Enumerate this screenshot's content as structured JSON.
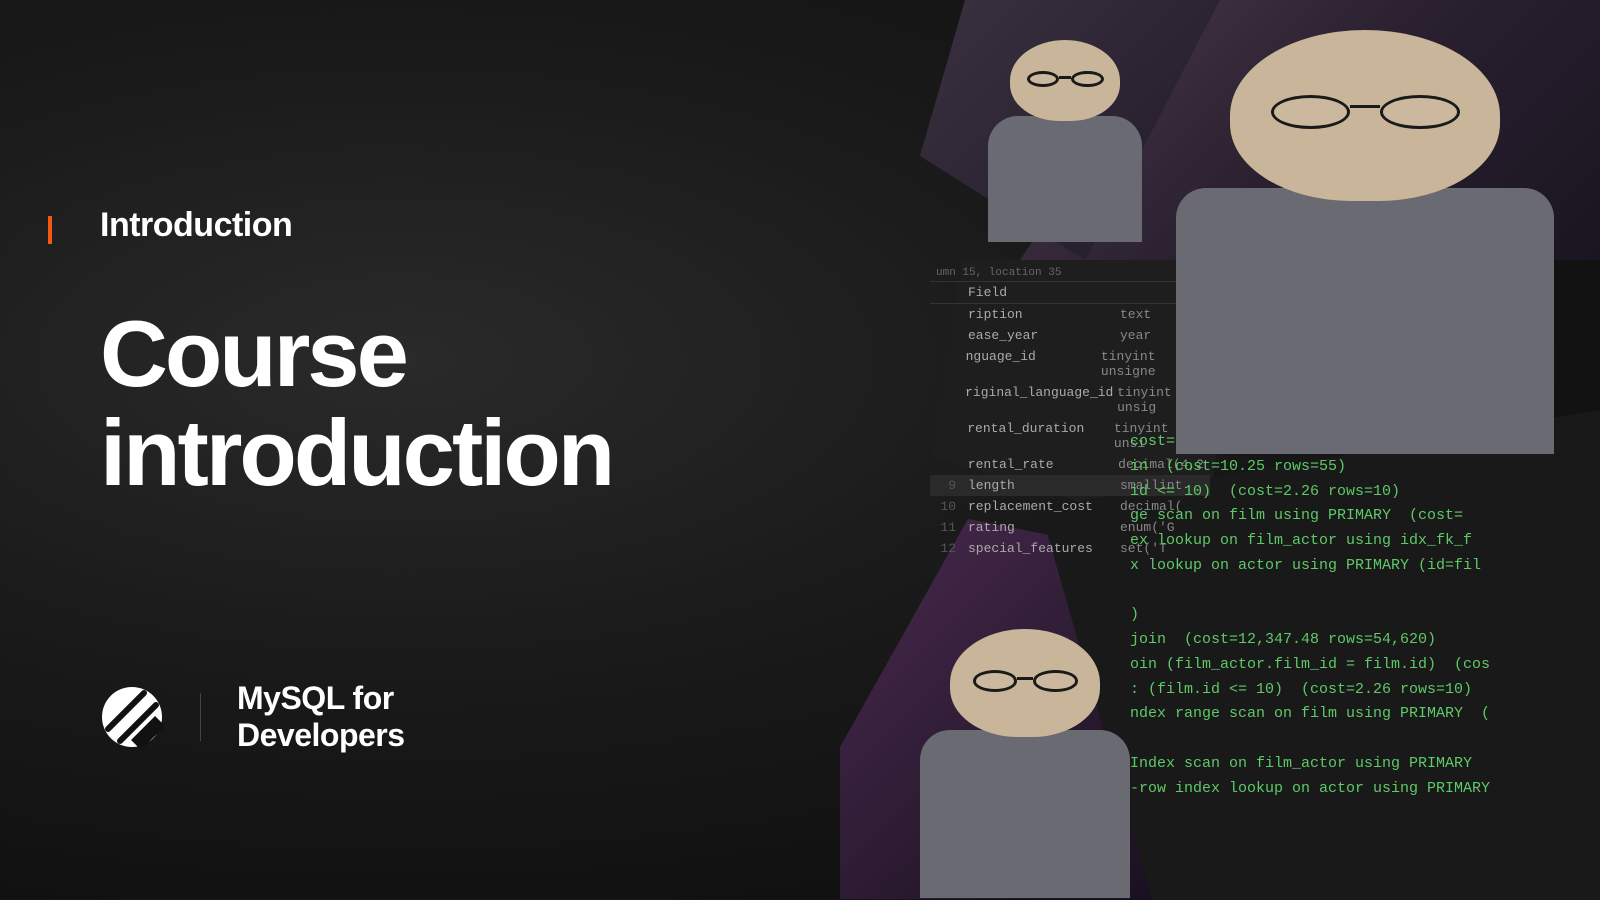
{
  "section_label": "Introduction",
  "title_line1": "Course",
  "title_line2": "introduction",
  "brand_line1": "MySQL for",
  "brand_line2": "Developers",
  "schema": {
    "location_text": "umn 15, location 35",
    "header_field": "Field",
    "rows": [
      {
        "num": "",
        "field": "ription",
        "type": "text",
        "hl": false
      },
      {
        "num": "",
        "field": "ease_year",
        "type": "year",
        "hl": false
      },
      {
        "num": "",
        "field": "nguage_id",
        "type": "tinyint unsigne",
        "hl": false
      },
      {
        "num": "",
        "field": "riginal_language_id",
        "type": "tinyint unsig",
        "hl": false
      },
      {
        "num": "",
        "field": "rental_duration",
        "type": "tinyint unsi",
        "hl": false
      },
      {
        "num": "",
        "field": "rental_rate",
        "type": "decimal(4,2",
        "hl": false
      },
      {
        "num": "9",
        "field": "length",
        "type": "smallint",
        "hl": true
      },
      {
        "num": "10",
        "field": "replacement_cost",
        "type": "decimal(",
        "hl": false
      },
      {
        "num": "11",
        "field": "rating",
        "type": "enum('G",
        "hl": false
      },
      {
        "num": "12",
        "field": "special_features",
        "type": "set('T",
        "hl": false
      }
    ]
  },
  "terminal_lines": [
    "cost=29.42 rows=55)",
    "in  (cost=10.25 rows=55)",
    "id <= 10)  (cost=2.26 rows=10)",
    "ge scan on film using PRIMARY  (cost=",
    "ex lookup on film_actor using idx_fk_f",
    "x lookup on actor using PRIMARY (id=fil",
    "",
    ")",
    "join  (cost=12,347.48 rows=54,620)",
    "oin (film_actor.film_id = film.id)  (cos",
    ": (film.id <= 10)  (cost=2.26 rows=10)",
    "ndex range scan on film using PRIMARY  (",
    "",
    "Index scan on film_actor using PRIMARY",
    "-row index lookup on actor using PRIMARY"
  ]
}
